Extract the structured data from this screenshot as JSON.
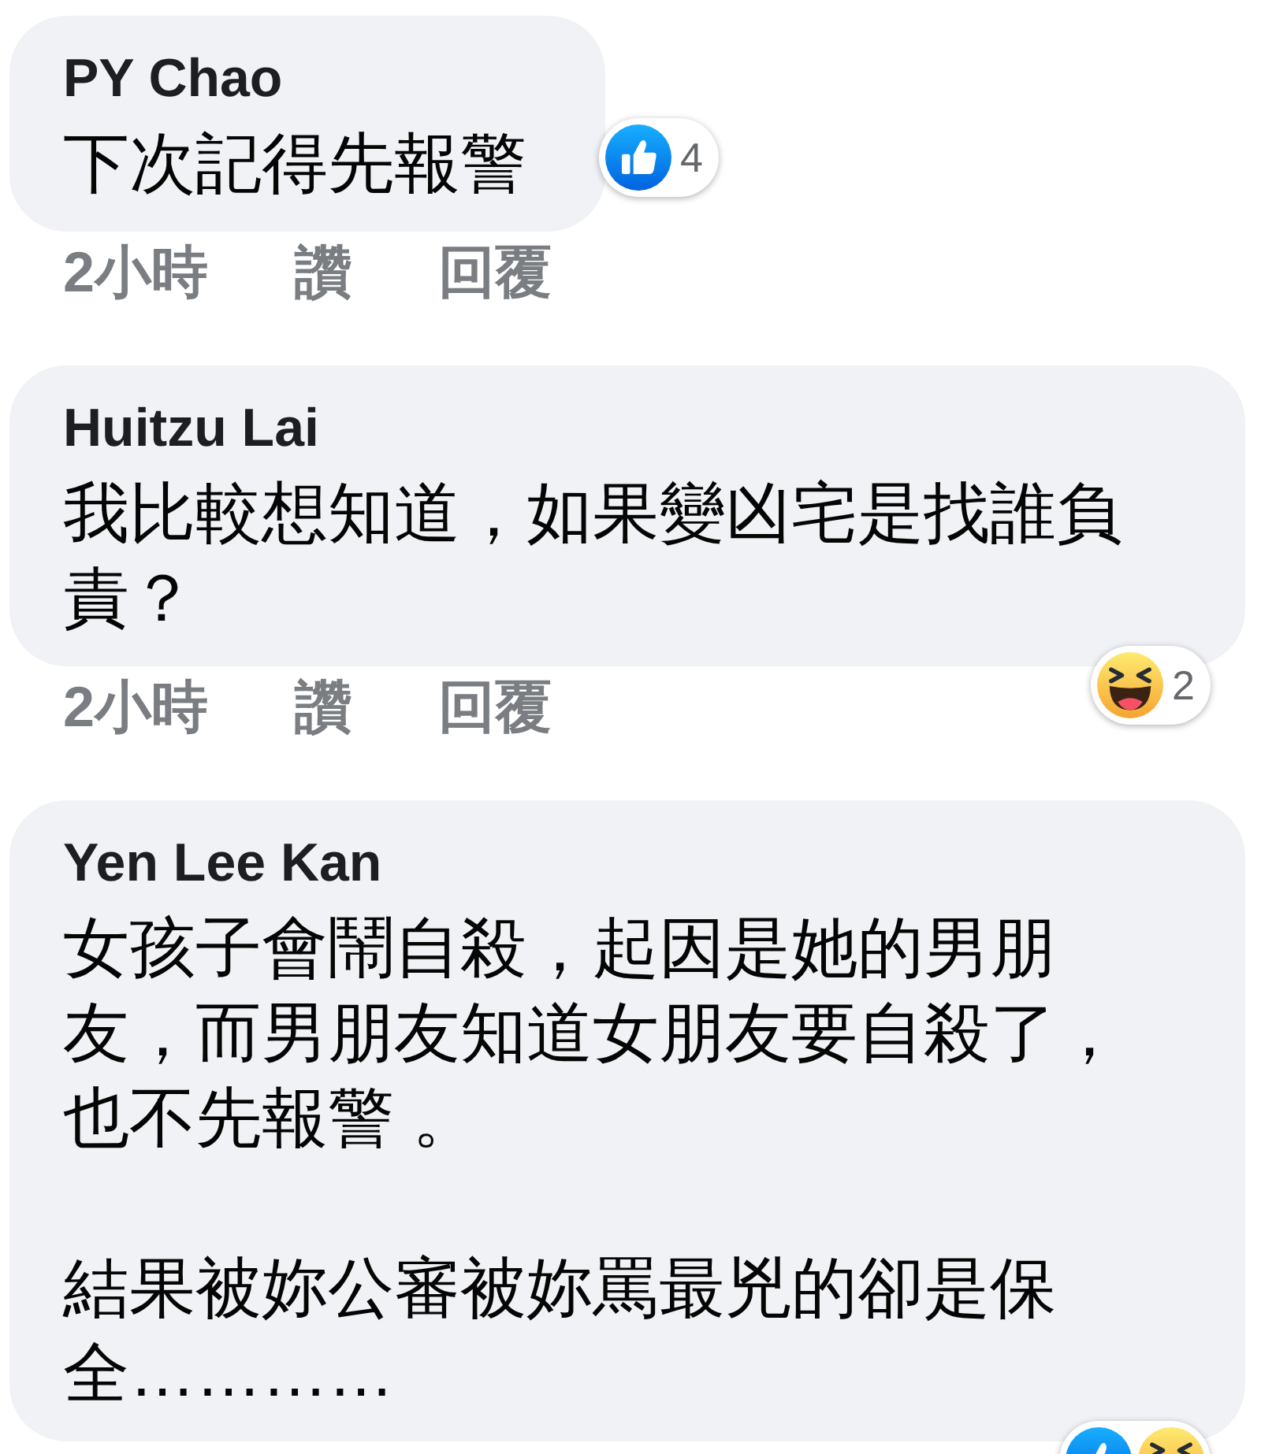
{
  "comments": [
    {
      "author": "PY Chao",
      "paragraphs": [
        "下次記得先報警"
      ],
      "reactions": {
        "icons": [
          {
            "kind": "like"
          }
        ],
        "count": "4"
      },
      "time": "2小時",
      "actions": [
        "讚",
        "回覆"
      ]
    },
    {
      "author": "Huitzu Lai",
      "paragraphs": [
        "我比較想知道，如果變凶宅是找誰負責？"
      ],
      "reactions": {
        "icons": [
          {
            "kind": "haha"
          }
        ],
        "count": "2"
      },
      "time": "2小時",
      "actions": [
        "讚",
        "回覆"
      ]
    },
    {
      "author": "Yen Lee Kan",
      "paragraphs": [
        "女孩子會鬧自殺，起因是她的男朋友，而男朋友知道女朋友要自殺了，也不先報警 。",
        "結果被妳公審被妳罵最兇的卻是保全…………"
      ],
      "reactions": {
        "icons": [
          {
            "kind": "like"
          },
          {
            "kind": "haha"
          }
        ]
      }
    }
  ]
}
